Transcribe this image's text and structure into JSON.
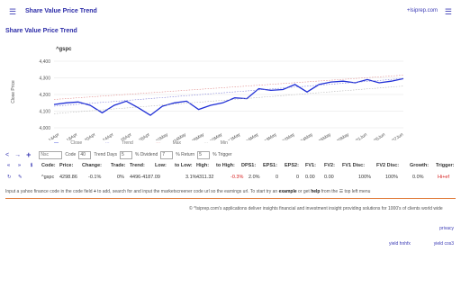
{
  "topbar": {
    "menu_icon": "menu-icon",
    "title": "Share Value Price Trend",
    "site": "+lsiprep.com",
    "menu2_icon": "menu-icon"
  },
  "page_title": "Share Value Price Trend",
  "ticker": "^gspc",
  "chart_data": {
    "type": "line",
    "title": "",
    "ylabel": "Close Price",
    "ylim": [
      4000,
      4400
    ],
    "yticks": [
      "4,400",
      "4,300",
      "4,200",
      "4,100",
      "4,000"
    ],
    "categories": [
      "14Apr",
      "18Apr",
      "20Apr",
      "24Apr",
      "26Apr",
      "28Apr",
      "02May",
      "04May",
      "08May",
      "10May",
      "12May",
      "16May",
      "18May",
      "22May",
      "24May",
      "26May",
      "30May",
      "01Jun",
      "05Jun",
      "07Jun"
    ],
    "series": [
      {
        "name": "Close",
        "color": "#1f2fd6",
        "values": [
          4140,
          4150,
          4155,
          4135,
          4090,
          4135,
          4160,
          4120,
          4075,
          4130,
          4150,
          4160,
          4110,
          4135,
          4150,
          4180,
          4175,
          4235,
          4225,
          4230,
          4260,
          4215,
          4260,
          4275,
          4280,
          4270,
          4290,
          4270,
          4280,
          4295
        ]
      },
      {
        "name": "Trend",
        "color": "#7d7dd8",
        "values": [
          4130,
          4296
        ]
      },
      {
        "name": "Max",
        "color": "#e08a8a",
        "values": [
          4170,
          4316
        ]
      },
      {
        "name": "Min",
        "color": "#b8b8b8",
        "values": [
          4085,
          4251
        ]
      }
    ]
  },
  "legend": [
    "Close",
    "Trend",
    "Max",
    "Min"
  ],
  "controls": {
    "prev": "<",
    "next": "→",
    "add": "+",
    "code_placeholder": "Nsc",
    "code_label": "Code",
    "trend_days_value": "40",
    "trend_days_label": "Trend Days",
    "dividend_value": "5",
    "dividend_label": "% Dividend",
    "return_value": "7",
    "return_label": "% Return",
    "trigger_value": "5",
    "trigger_label": "% Trigger"
  },
  "table": {
    "headers": [
      "«",
      "»",
      "ℹ",
      "Code:",
      "Price:",
      "Change:",
      "Trade:",
      "Trend:",
      "Low:",
      "to Low:",
      "High:",
      "to High:",
      "DPS1:",
      "EPS1:",
      "EPS2:",
      "FV1:",
      "FV2:",
      "FV1 Disc:",
      "FV2 Disc:",
      "Growth:",
      "Trigger:"
    ],
    "row": [
      "↻",
      "✎",
      "",
      "^gspc",
      "4298.86",
      "-0.1%",
      "0%",
      "4496-4187.09",
      "",
      "3.1%",
      "4311.32",
      "-0.3%",
      "2.0%",
      "0",
      "0",
      "0.00",
      "0.00",
      "100%",
      "100%",
      "0.0%",
      "Hi+ef"
    ]
  },
  "info": {
    "text1": "Input a ",
    "yahoo": "yahoo finance",
    "text2": " code in the code field ",
    "text3": " to add, search for and input the ",
    "marketscreener": "marketscreener",
    "text4": " code url so the earnings url. To start try an ",
    "example": "example",
    "text5": " or get ",
    "help": "help",
    "text6": " from the ",
    "menu": "☰ top left menu"
  },
  "footer_note": "© ^lsiprep.com's applications deliver insights financial and investment insight providing solutions for 1000's of clients world wide",
  "privacy": "privacy",
  "links": {
    "one": "yield hnhfx",
    "two": "yield cos3"
  }
}
